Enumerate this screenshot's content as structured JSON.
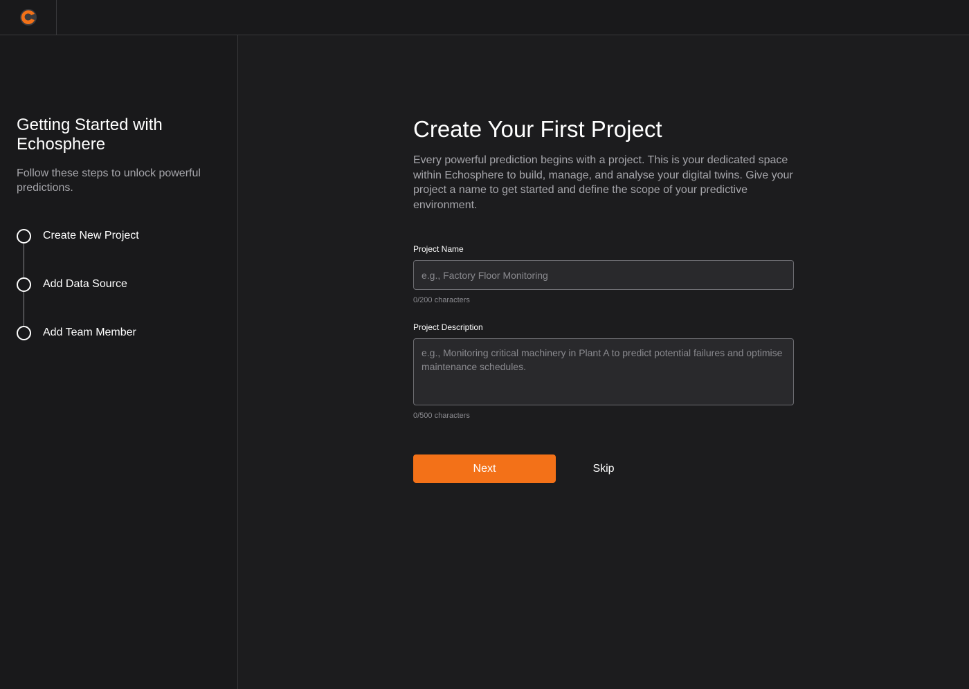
{
  "app": {
    "logo_icon": "echosphere-logo-icon",
    "accent_color": "#f37118"
  },
  "sidebar": {
    "title": "Getting Started with Echosphere",
    "subtitle": "Follow these steps to unlock powerful predictions.",
    "steps": [
      {
        "label": "Create New Project",
        "icon": "step-circle-icon"
      },
      {
        "label": "Add Data Source",
        "icon": "step-circle-icon"
      },
      {
        "label": "Add Team Member",
        "icon": "step-circle-icon"
      }
    ]
  },
  "main": {
    "title": "Create Your First Project",
    "description": "Every powerful prediction begins with a project. This is your dedicated space within Echosphere to build, manage, and analyse your digital twins. Give your project a name to get started and define the scope of your predictive environment.",
    "project_name": {
      "label": "Project Name",
      "value": "",
      "placeholder": "e.g., Factory Floor Monitoring",
      "counter": "0/200 characters"
    },
    "project_description": {
      "label": "Project Description",
      "value": "",
      "placeholder": "e.g., Monitoring critical machinery in Plant A to predict potential failures and optimise maintenance schedules.",
      "counter": "0/500 characters"
    },
    "next_label": "Next",
    "skip_label": "Skip"
  }
}
